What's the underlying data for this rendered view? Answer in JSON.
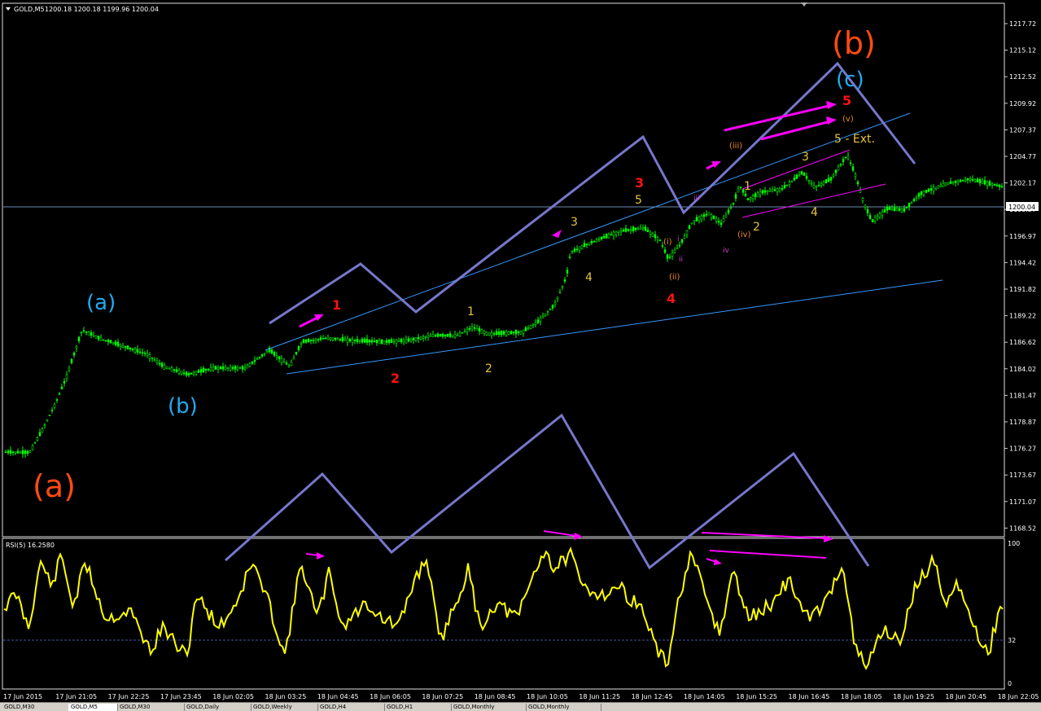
{
  "header": {
    "symbol_label": "GOLD,M5",
    "ohlc": "1200.18 1200.18 1199.96 1200.04"
  },
  "price_axis": {
    "ticks": [
      "1217.72",
      "1215.12",
      "1212.52",
      "1209.92",
      "1207.37",
      "1204.77",
      "1202.17",
      "1199.57",
      "1196.97",
      "1194.42",
      "1191.82",
      "1189.22",
      "1186.62",
      "1184.02",
      "1181.47",
      "1178.87",
      "1176.27",
      "1173.67",
      "1171.07",
      "1168.52"
    ],
    "current_price": "1200.04"
  },
  "time_axis": {
    "labels": [
      "17 Jun 2015",
      "17 Jun 21:05",
      "17 Jun 22:25",
      "17 Jun 23:45",
      "18 Jun 02:05",
      "18 Jun 03:25",
      "18 Jun 04:45",
      "18 Jun 06:05",
      "18 Jun 07:25",
      "18 Jun 08:45",
      "18 Jun 10:05",
      "18 Jun 11:25",
      "18 Jun 12:45",
      "18 Jun 14:05",
      "18 Jun 15:25",
      "18 Jun 16:45",
      "18 Jun 18:05",
      "18 Jun 19:25",
      "18 Jun 20:45",
      "18 Jun 22:05"
    ]
  },
  "rsi_panel": {
    "label": "RSI(5) 16.2580",
    "levels": [
      "100",
      "32",
      "0"
    ]
  },
  "wave_labels": {
    "a_big": "(a)",
    "b_big": "(b)",
    "a_small": "(a)",
    "b_small": "(b)",
    "c_small": "(c)",
    "red_1": "1",
    "red_2": "2",
    "red_3": "3",
    "red_4": "4",
    "red_5": "5",
    "y1": "1",
    "y2": "2",
    "y3": "3",
    "y4": "4",
    "y5": "5",
    "y1b": "1",
    "y2b": "2",
    "y3b": "3",
    "y4b": "4",
    "y5ext": "5 - Ext.",
    "roman_i": "(i)",
    "roman_ii": "(ii)",
    "roman_iii": "(iii)",
    "roman_iv": "(iv)",
    "roman_v": "(v)",
    "small_i": "i",
    "small_ii": "ii",
    "small_iii": "iii",
    "small_iv": "iv"
  },
  "tabs": [
    "GOLD,M30",
    "GOLD,M5",
    "GOLD,M30",
    "GOLD,Daily",
    "GOLD,Weekly",
    "GOLD,H4",
    "GOLD,H1",
    "GOLD,Monthly",
    "GOLD,Monthly"
  ],
  "colors": {
    "candles": "#00ff00",
    "rsi": "#ffff00",
    "trendline": "#3399ff",
    "zigzag": "#7777cc",
    "arrows": "#ff00ff",
    "wave_orange": "#ff4a12",
    "wave_blue": "#22aaee",
    "wave_red": "#ff1111",
    "wave_yellow": "#e6c33a"
  }
}
